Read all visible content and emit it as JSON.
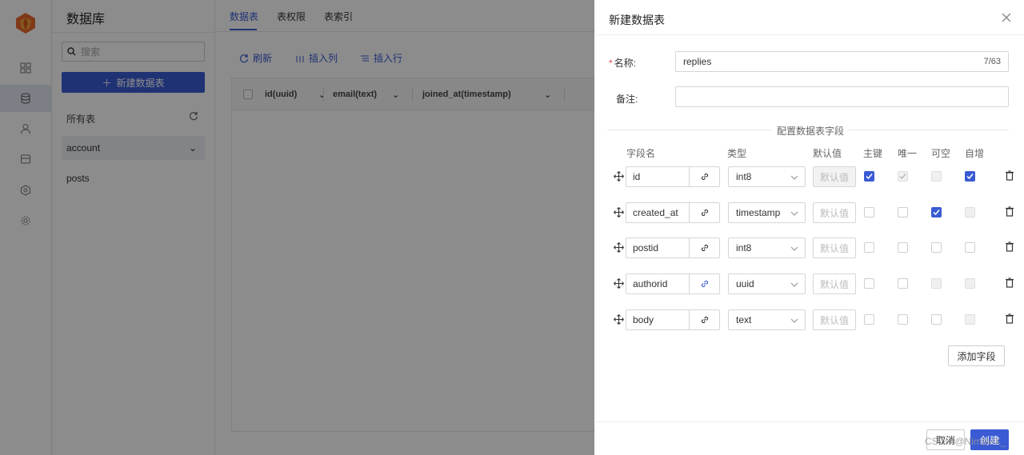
{
  "sidebar": {
    "title": "数据库",
    "search_placeholder": "搜索",
    "new_table_label": "新建数据表",
    "all_tables_label": "所有表",
    "tables": [
      "account",
      "posts"
    ]
  },
  "main": {
    "tabs": [
      "数据表",
      "表权限",
      "表索引"
    ],
    "toolbar": {
      "refresh": "刷新",
      "insert_column": "插入列",
      "insert_row": "插入行"
    },
    "columns": [
      "id(uuid)",
      "email(text)",
      "joined_at(timestamp)"
    ]
  },
  "drawer": {
    "title": "新建数据表",
    "name_label": "名称:",
    "name_value": "replies",
    "name_counter": "7/63",
    "remark_label": "备注:",
    "section_title": "配置数据表字段",
    "headers": {
      "field_name": "字段名",
      "type": "类型",
      "default": "默认值",
      "primary_key": "主键",
      "unique": "唯一",
      "nullable": "可空",
      "auto_increment": "自增"
    },
    "default_placeholder": "默认值",
    "fields": [
      {
        "name": "id",
        "type": "int8",
        "primary_key": true,
        "unique": true,
        "nullable": false,
        "auto_increment": true
      },
      {
        "name": "created_at",
        "type": "timestamp",
        "primary_key": false,
        "unique": false,
        "nullable": true,
        "auto_increment": false
      },
      {
        "name": "postid",
        "type": "int8",
        "primary_key": false,
        "unique": false,
        "nullable": false,
        "auto_increment": false
      },
      {
        "name": "authorid",
        "type": "uuid",
        "primary_key": false,
        "unique": false,
        "nullable": false,
        "auto_increment": false
      },
      {
        "name": "body",
        "type": "text",
        "primary_key": false,
        "unique": false,
        "nullable": false,
        "auto_increment": false
      }
    ],
    "add_field_label": "添加字段",
    "cancel_label": "取消",
    "create_label": "创建",
    "watermark": "CSDN @NimbleX_"
  },
  "colors": {
    "accent": "#3a5bd3",
    "required": "#e34b4b",
    "link_icon_active": "#3a5bd3"
  }
}
